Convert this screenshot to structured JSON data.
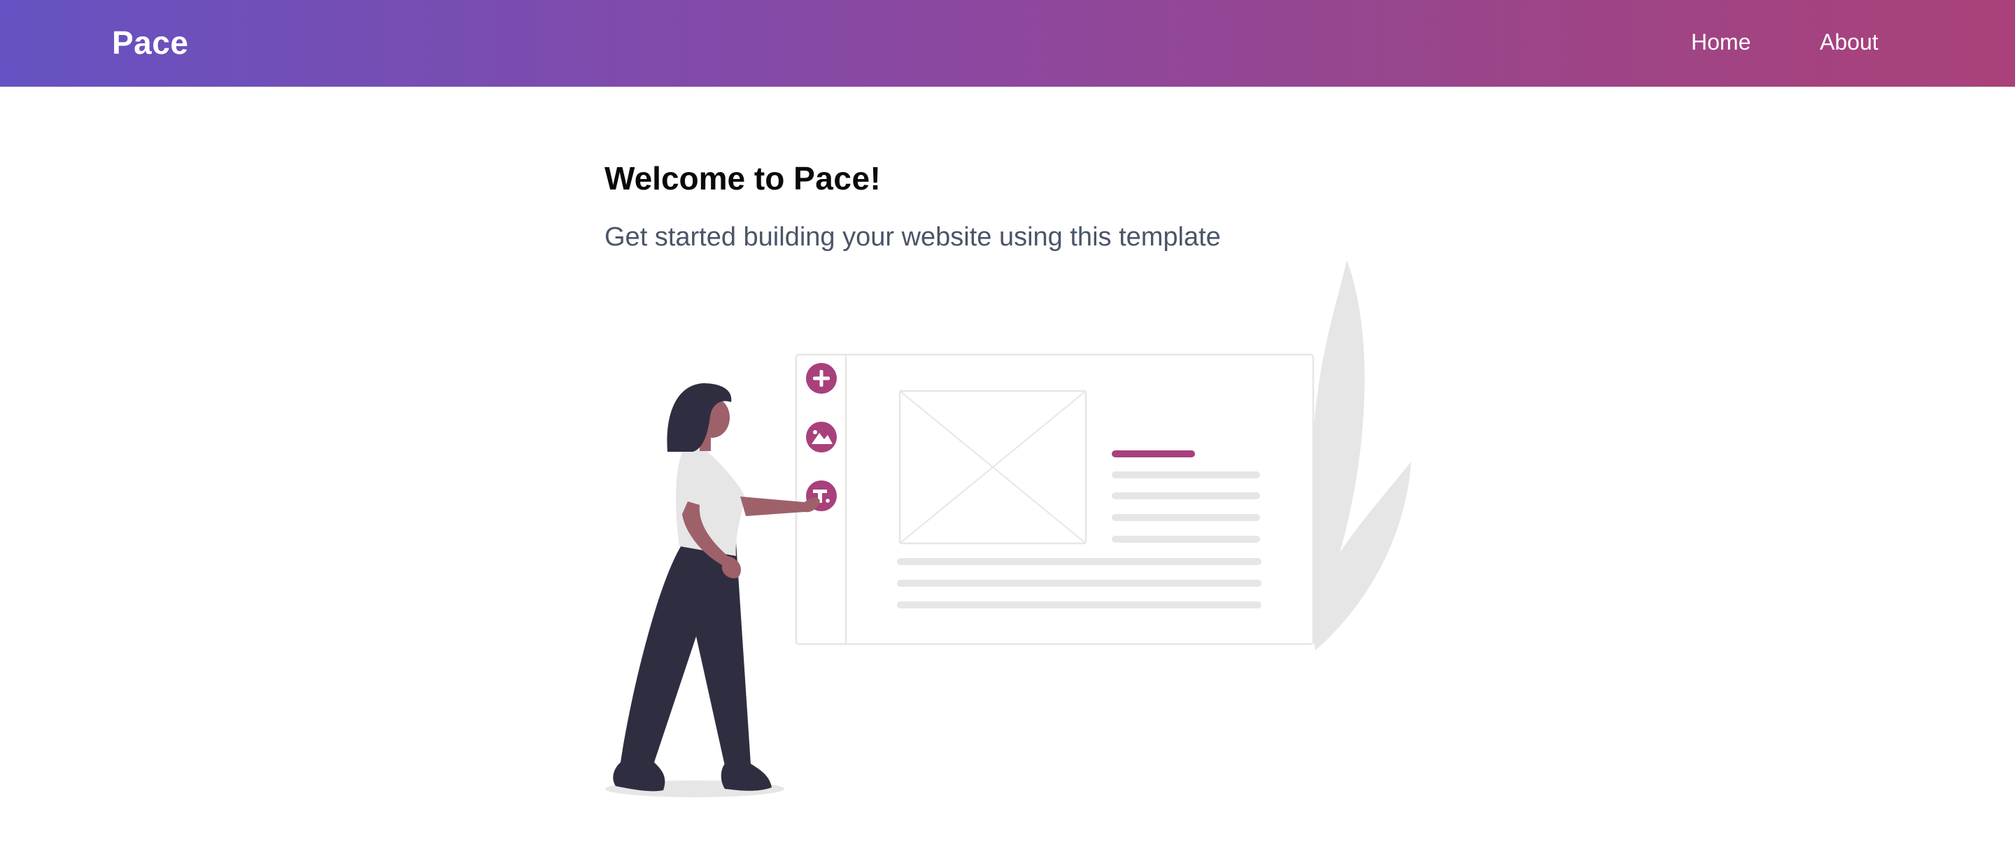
{
  "navbar": {
    "brand": "Pace",
    "links": [
      {
        "label": "Home"
      },
      {
        "label": "About"
      }
    ]
  },
  "hero": {
    "title_prefix": "Welcome to ",
    "title_brand": "Pace",
    "title_suffix": "!",
    "subtitle": "Get started building your website using this template"
  },
  "illustration": {
    "icons": [
      "add-icon",
      "image-icon",
      "text-icon"
    ],
    "accent_color": "#a8407c"
  },
  "colors": {
    "nav_gradient_start": "#6652c2",
    "nav_gradient_end": "#aa417a",
    "accent": "#a8407c",
    "subtitle_text": "#4a5568",
    "figure_dark": "#2f2e41",
    "skin": "#9e616a",
    "placeholder_gray": "#e6e6e6"
  }
}
